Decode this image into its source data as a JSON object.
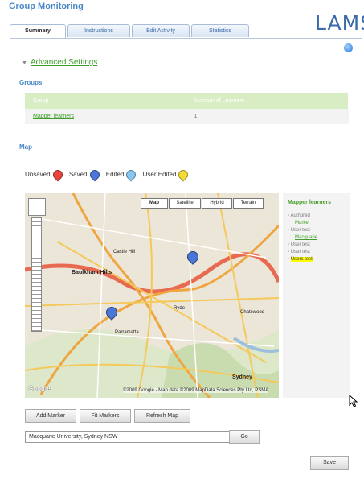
{
  "header": {
    "title": "Group Monitoring",
    "logo": "LAMS"
  },
  "tabs": [
    "Summary",
    "Instructions",
    "Edit Activity",
    "Statistics"
  ],
  "advanced_settings": {
    "arrow": "▼",
    "label": "Advanced Settings"
  },
  "groups": {
    "title": "Groups",
    "columns": [
      "Group",
      "Number of Learners"
    ],
    "rows": [
      {
        "group": "Mapper learners",
        "learners": "1"
      }
    ]
  },
  "map_section": {
    "title": "Map",
    "legend": [
      {
        "label": "Unsaved",
        "color": "#e8453c",
        "icon": "red-marker-icon"
      },
      {
        "label": "Saved",
        "color": "#4a76d8",
        "icon": "blue-marker-icon"
      },
      {
        "label": "Edited",
        "color": "#86c7f2",
        "icon": "light-blue-marker-icon"
      },
      {
        "label": "User Edited",
        "color": "#f4dc38",
        "icon": "yellow-marker-icon"
      }
    ],
    "map_types": [
      "Map",
      "Satellite",
      "Hybrid",
      "Terrain"
    ],
    "place_labels": [
      "Baulkham Hills",
      "Castle Hill",
      "Parramatta",
      "Sydney",
      "Chatswood",
      "Ryde"
    ],
    "copyright": "©2009 Google - Map data ©2009 MapData Sciences Pty Ltd, PSMA",
    "google_logo": "Google"
  },
  "sidebar": {
    "title": "Mapper learners",
    "items": [
      {
        "text": "Authored",
        "type": "text"
      },
      {
        "text": "Marker",
        "type": "link"
      },
      {
        "text": "User test",
        "type": "text"
      },
      {
        "text": "Macquarie",
        "type": "link"
      },
      {
        "text": "User test",
        "type": "text"
      },
      {
        "text": "User test",
        "type": "text"
      },
      {
        "text": "Users test",
        "type": "highlight"
      }
    ]
  },
  "actions": {
    "add_marker": "Add Marker",
    "fit_markers": "Fit Markers",
    "refresh_map": "Refresh Map"
  },
  "address": {
    "value": "Macquarie University, Sydney NSW",
    "go": "Go"
  },
  "save_button": "Save"
}
